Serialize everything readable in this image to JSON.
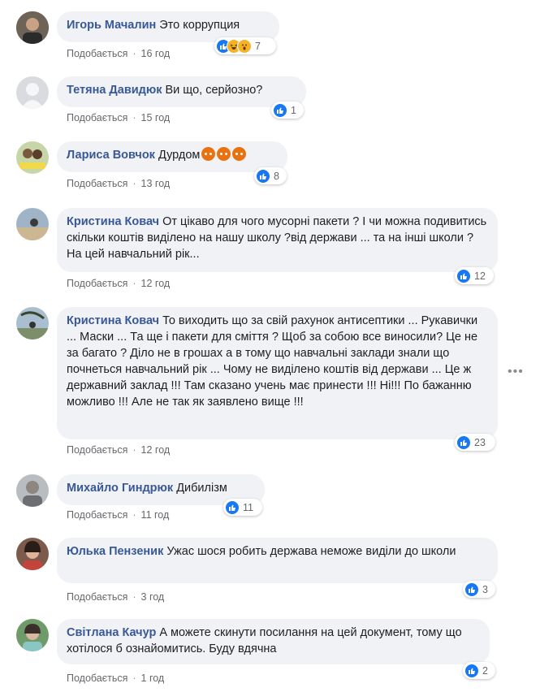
{
  "comments": [
    {
      "author": "Игорь Мачалин",
      "text": "Это коррупция",
      "like_label": "Подобається",
      "time": "16 год",
      "reactions": "7",
      "reaction_icons": [
        "like-icon",
        "haha-icon",
        "wow-icon"
      ]
    },
    {
      "author": "Тетяна Давидюк",
      "text": "Ви що, серйозно?",
      "like_label": "Подобається",
      "time": "15 год",
      "reactions": "1",
      "reaction_icons": [
        "like-icon"
      ]
    },
    {
      "author": "Лариса Вовчок",
      "text": "Дурдом",
      "like_label": "Подобається",
      "time": "13 год",
      "reactions": "8",
      "reaction_icons": [
        "like-icon"
      ],
      "inline_emojis": [
        "angry-emoji",
        "angry-emoji",
        "angry-emoji"
      ]
    },
    {
      "author": "Кристина Ковач",
      "text": "От цікаво для чого мусорні пакети ? І чи можна подивитись скільки коштів виділено на нашу школу ?від держави ... та на інші школи ? На цей навчальний рік...",
      "like_label": "Подобається",
      "time": "12 год",
      "reactions": "12",
      "reaction_icons": [
        "like-icon"
      ]
    },
    {
      "author": "Кристина Ковач",
      "text": "То виходить що за свій рахунок антисептики ... Рукавички ... Маски ... Та ще і пакети для сміття ? Щоб за собою все виносили? Це не за багато ? Діло не в грошах а в тому що навчальні заклади знали що почнеться навчальний рік ... Чому не виділено коштів від держави ... Це ж державний заклад !!! Там сказано учень має принести !!! Ні!!! По бажанню можливо !!! Але не так як заявлено вище !!!",
      "like_label": "Подобається",
      "time": "12 год",
      "reactions": "23",
      "reaction_icons": [
        "like-icon"
      ]
    },
    {
      "author": "Михайло Гиндрюк",
      "text": "Дибилізм",
      "like_label": "Подобається",
      "time": "11 год",
      "reactions": "11",
      "reaction_icons": [
        "like-icon"
      ]
    },
    {
      "author": "Юлька Пензеник",
      "text": "Ужас шося робить держава неможе виділи до школи",
      "like_label": "Подобається",
      "time": "3 год",
      "reactions": "3",
      "reaction_icons": [
        "like-icon"
      ]
    },
    {
      "author": "Світлана Качур",
      "text": "А можете скинути посилання на цей документ, тому що хотілося б ознайомитись. Буду вдячна",
      "like_label": "Подобається",
      "time": "1 год",
      "reactions": "2",
      "reaction_icons": [
        "like-icon"
      ]
    }
  ],
  "more_options_icon": "more-options-icon",
  "colors": {
    "author": "#385898",
    "bubble": "#f0f2f5",
    "meta": "#65676b",
    "like": "#1877f2"
  }
}
